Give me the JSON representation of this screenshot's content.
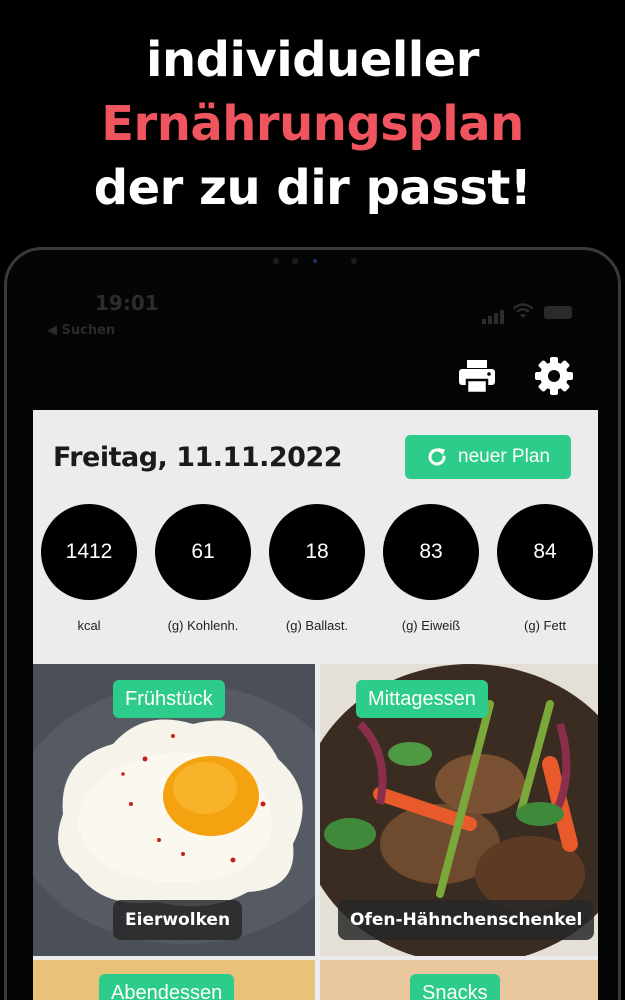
{
  "headline": {
    "line1": "individueller",
    "line2": "Ernährungsplan",
    "line3": "der zu dir passt!"
  },
  "colors": {
    "accent": "#f0555f",
    "green": "#2ecc8a",
    "background": "#000000",
    "panel": "#ececee"
  },
  "status_bar": {
    "time": "19:01",
    "back_label": "◀ Suchen"
  },
  "toolbar": {
    "print_icon": "printer-icon",
    "settings_icon": "gear-icon"
  },
  "plan": {
    "date": "Freitag, 11.11.2022",
    "new_plan_label": "neuer Plan",
    "new_plan_icon": "refresh-icon"
  },
  "stats": [
    {
      "value": "1412",
      "label": "kcal"
    },
    {
      "value": "61",
      "label": "(g) Kohlenh."
    },
    {
      "value": "18",
      "label": "(g) Ballast."
    },
    {
      "value": "83",
      "label": "(g) Eiweiß"
    },
    {
      "value": "84",
      "label": "(g) Fett"
    }
  ],
  "meals": [
    {
      "category": "Frühstück",
      "dish": "Eierwolken"
    },
    {
      "category": "Mittagessen",
      "dish": "Ofen-Hähnchenschenkel"
    },
    {
      "category": "Abendessen",
      "dish": ""
    },
    {
      "category": "Snacks",
      "dish": ""
    }
  ]
}
